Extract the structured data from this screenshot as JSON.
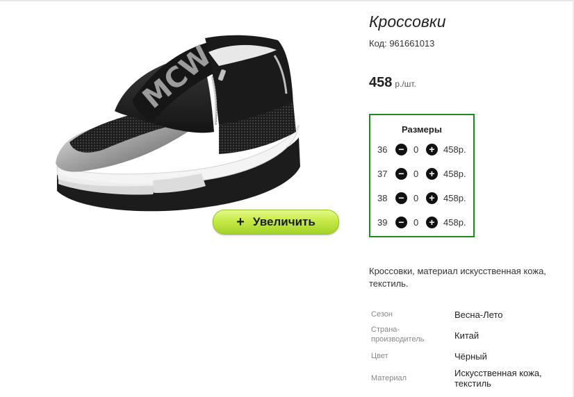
{
  "product": {
    "title": "Кроссовки",
    "code": "Код: 961661013",
    "price_value": "458",
    "price_unit": "р./шт.",
    "description": "Кроссовки, материал искусственная кожа, текстиль.",
    "image_logo_text": "MCW"
  },
  "zoom_button": {
    "icon": "+",
    "label": "Увеличить"
  },
  "sizes": {
    "title": "Размеры",
    "minus_icon": "−",
    "plus_icon": "+",
    "rows": [
      {
        "size": "36",
        "qty": "0",
        "price": "458р."
      },
      {
        "size": "37",
        "qty": "0",
        "price": "458р."
      },
      {
        "size": "38",
        "qty": "0",
        "price": "458р."
      },
      {
        "size": "39",
        "qty": "0",
        "price": "458р."
      }
    ]
  },
  "attributes": [
    {
      "key": "Сезон",
      "value": "Весна-Лето"
    },
    {
      "key": "Страна-производитель",
      "value": "Китай"
    },
    {
      "key": "Цвет",
      "value": "Чёрный"
    },
    {
      "key": "Материал",
      "value": "Искусственная кожа, текстиль"
    }
  ],
  "colors": {
    "accent_green": "#1f8a1f",
    "button_green": "#c6ea45",
    "icon_black": "#111111"
  }
}
